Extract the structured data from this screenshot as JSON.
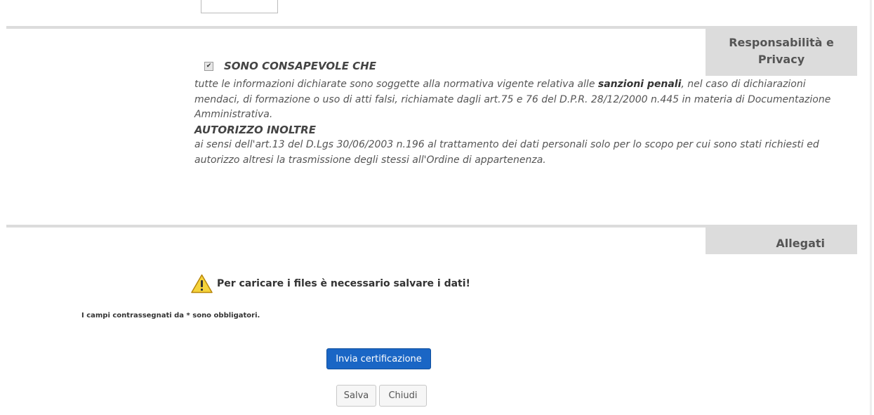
{
  "sections": {
    "privacy_tab": "Responsabilità e Privacy",
    "allegati_tab": "Allegati"
  },
  "consent": {
    "checked": true,
    "title": "SONO CONSAPEVOLE CHE",
    "text_before": "tutte le informazioni dichiarate sono soggette alla normativa vigente relativa alle ",
    "text_bold": "sanzioni penali",
    "text_after": ", nel caso di dichiarazioni mendaci, di formazione o uso di atti falsi, richiamate dagli art.75 e 76 del D.P.R. 28/12/2000 n.445 in materia di Documentazione Amministrativa.",
    "auth_heading": "AUTORIZZO INOLTRE",
    "auth_text": "ai sensi dell'art.13 del D.Lgs 30/06/2003 n.196 al trattamento dei dati personali solo per lo scopo per cui sono stati richiesti ed autorizzo altresi la trasmissione degli stessi all'Ordine di appartenenza."
  },
  "warning": {
    "icon": "warning-icon",
    "text": "Per caricare i files è necessario salvare i dati!"
  },
  "required_note": "I campi contrassegnati da * sono obbligatori.",
  "buttons": {
    "submit": "Invia certificazione",
    "save": "Salva",
    "close": "Chiudi"
  },
  "colors": {
    "primary": "#1a66c5",
    "section_bg": "#dcdcdc"
  }
}
